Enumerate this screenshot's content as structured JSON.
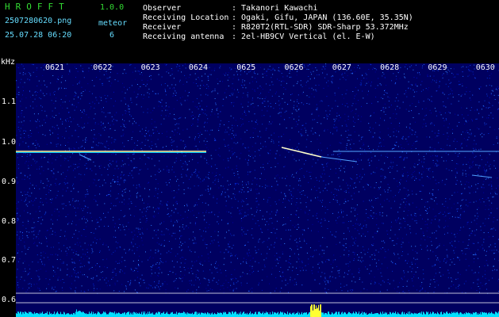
{
  "header": {
    "app_name": "HROFFT",
    "version": "1.0.0",
    "filename": "2507280620.png",
    "datetime": "25.07.28 06:20",
    "meteor_label": "meteor",
    "meteor_count": "6"
  },
  "info": {
    "observer_label": "Observer",
    "observer_value": ": Takanori Kawachi",
    "location_label": "Receiving Location",
    "location_value": ": Ogaki, Gifu, JAPAN (136.60E, 35.35N)",
    "receiver_label": "Receiver",
    "receiver_value": ": R820T2(RTL-SDR) SDR-Sharp 53.372MHz",
    "antenna_label": "Receiving antenna",
    "antenna_value": ": 2el-HB9CV Vertical (el. E-W)"
  },
  "axis": {
    "unit": "kHz",
    "time_ticks": [
      "0621",
      "0622",
      "0623",
      "0624",
      "0625",
      "0626",
      "0627",
      "0628",
      "0629",
      "0630"
    ],
    "freq_ticks": [
      "1.1",
      "1.0",
      "0.9",
      "0.8",
      "0.7",
      "0.6"
    ]
  },
  "colors": {
    "background": "#000060",
    "carrier": "#ffff99",
    "text_green": "#33dd33",
    "text_cyan": "#66ddff"
  }
}
